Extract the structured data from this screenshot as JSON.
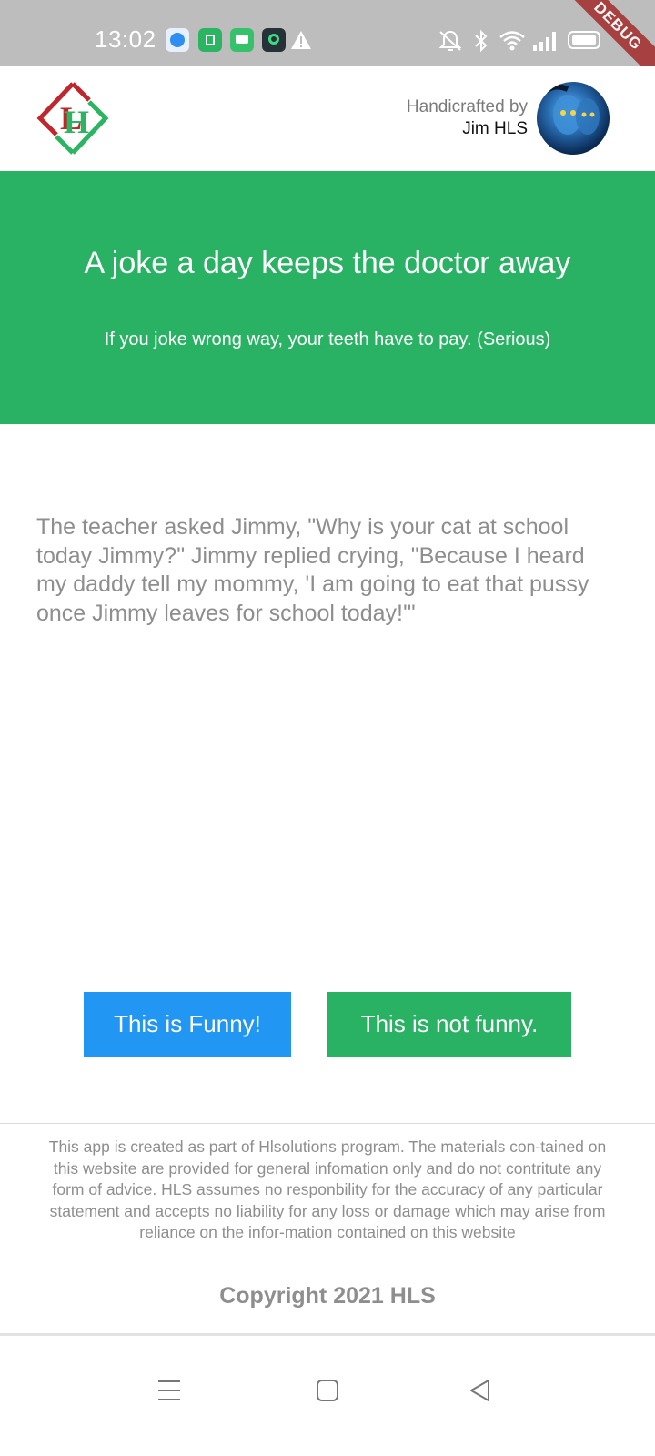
{
  "status_bar": {
    "time": "13:02",
    "notification_icons": [
      "browser-app-icon",
      "android-app-icon",
      "messages-app-icon",
      "green-app-icon",
      "warning-icon"
    ],
    "system_icons": [
      "silent-bell-icon",
      "bluetooth-icon",
      "wifi-icon",
      "cellular-signal-icon",
      "battery-icon"
    ]
  },
  "debug_banner": "DEBUG",
  "header": {
    "credit_label": "Handicrafted by",
    "credit_name": "Jim HLS"
  },
  "hero": {
    "title": "A joke a day keeps the doctor away",
    "subtitle": "If you joke wrong way, your teeth have to pay. (Serious)"
  },
  "joke": {
    "text": "The teacher asked Jimmy, \"Why is your cat at school today Jimmy?\" Jimmy replied crying, \"Because I heard my daddy tell my mommy, 'I am going to eat that pussy once Jimmy leaves for school today!'\""
  },
  "buttons": {
    "funny_label": "This is Funny!",
    "not_funny_label": "This is not funny."
  },
  "footer": {
    "disclaimer": "This app is created as part of Hlsolutions program. The materials con-tained on this website are provided for general infomation only and do not contritute any form of advice. HLS assumes no responbility for the accuracy of any particular statement and accepts no liability for any loss or damage which may arise from reliance on the infor-mation contained on this website",
    "copyright": "Copyright 2021 HLS"
  },
  "colors": {
    "primary_green": "#29b263",
    "primary_blue": "#2196f3",
    "status_bar_gray": "#bdbdbd",
    "text_gray": "#8e8e8e",
    "logo_red": "#c0272d"
  }
}
